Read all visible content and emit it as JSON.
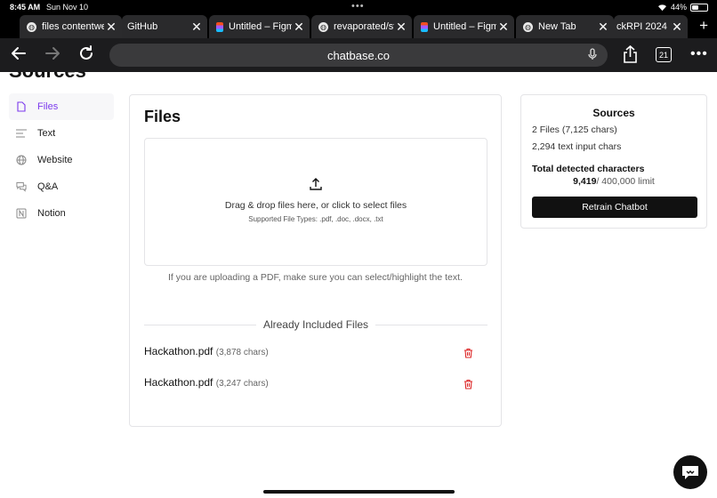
{
  "status_bar": {
    "time": "8:45 AM",
    "date": "Sun Nov 10",
    "battery": "44%",
    "battery_level": 0.44
  },
  "tabs": [
    {
      "label": "files contentwe",
      "icon": "globe-icon",
      "active": true
    },
    {
      "label": "GitHub",
      "icon": "github-icon"
    },
    {
      "label": "Untitled – Figma",
      "icon": "figma-icon"
    },
    {
      "label": "revaporated/st",
      "icon": "globe-icon"
    },
    {
      "label": "Untitled – Figma",
      "icon": "figma-icon"
    },
    {
      "label": "New Tab",
      "icon": "globe-icon"
    },
    {
      "label": "ckRPI 2024",
      "icon": "none"
    }
  ],
  "toolbar": {
    "url": "chatbase.co",
    "tab_count": "21"
  },
  "page": {
    "heading": "Sources",
    "sidebar": [
      {
        "label": "Files",
        "icon": "file-icon",
        "active": true
      },
      {
        "label": "Text",
        "icon": "text-lines-icon"
      },
      {
        "label": "Website",
        "icon": "globe-icon"
      },
      {
        "label": "Q&A",
        "icon": "chat-icon"
      },
      {
        "label": "Notion",
        "icon": "notion-icon"
      }
    ],
    "files": {
      "title": "Files",
      "dropzone_text": "Drag & drop files here, or click to select files",
      "dropzone_subtext": "Supported File Types: .pdf, .doc, .docx, .txt",
      "pdf_note": "If you are uploading a PDF, make sure you can select/highlight the text.",
      "included_heading": "Already Included Files",
      "included": [
        {
          "name": "Hackathon.pdf",
          "chars": "(3,878 chars)"
        },
        {
          "name": "Hackathon.pdf",
          "chars": "(3,247 chars)"
        }
      ]
    },
    "sources": {
      "title": "Sources",
      "files_line": "2 Files (7,125 chars)",
      "text_line": "2,294 text input chars",
      "total_label": "Total detected characters",
      "total_value": "9,419",
      "limit": "/ 400,000 limit",
      "retrain_label": "Retrain Chatbot"
    }
  },
  "colors": {
    "accent": "#7c3aed",
    "trash": "#dc2626",
    "button_bg": "#111111"
  }
}
